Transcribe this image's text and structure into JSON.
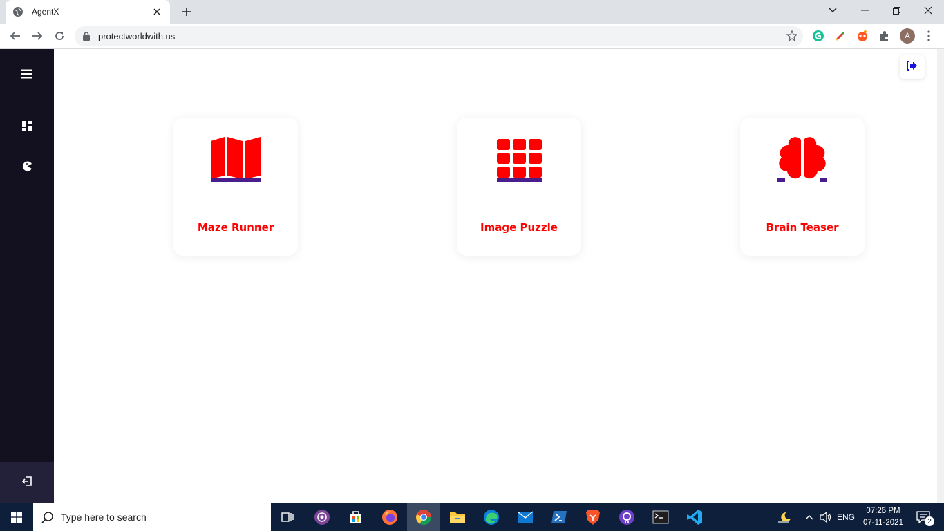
{
  "browser": {
    "tab_title": "AgentX",
    "url": "protectworldwith.us",
    "profile_initial": "A"
  },
  "cards": [
    {
      "label": "Maze Runner",
      "icon": "map-icon"
    },
    {
      "label": "Image Puzzle",
      "icon": "grid-icon"
    },
    {
      "label": "Brain Teaser",
      "icon": "brain-icon"
    }
  ],
  "taskbar": {
    "search_placeholder": "Type here to search",
    "language": "ENG",
    "time": "07:26 PM",
    "date": "07-11-2021",
    "notification_count": "2"
  },
  "colors": {
    "sidebar": "#13111f",
    "accent_red": "#ff0000",
    "accent_purple": "#4a1d8c",
    "logout_blue": "#1a16d9"
  }
}
